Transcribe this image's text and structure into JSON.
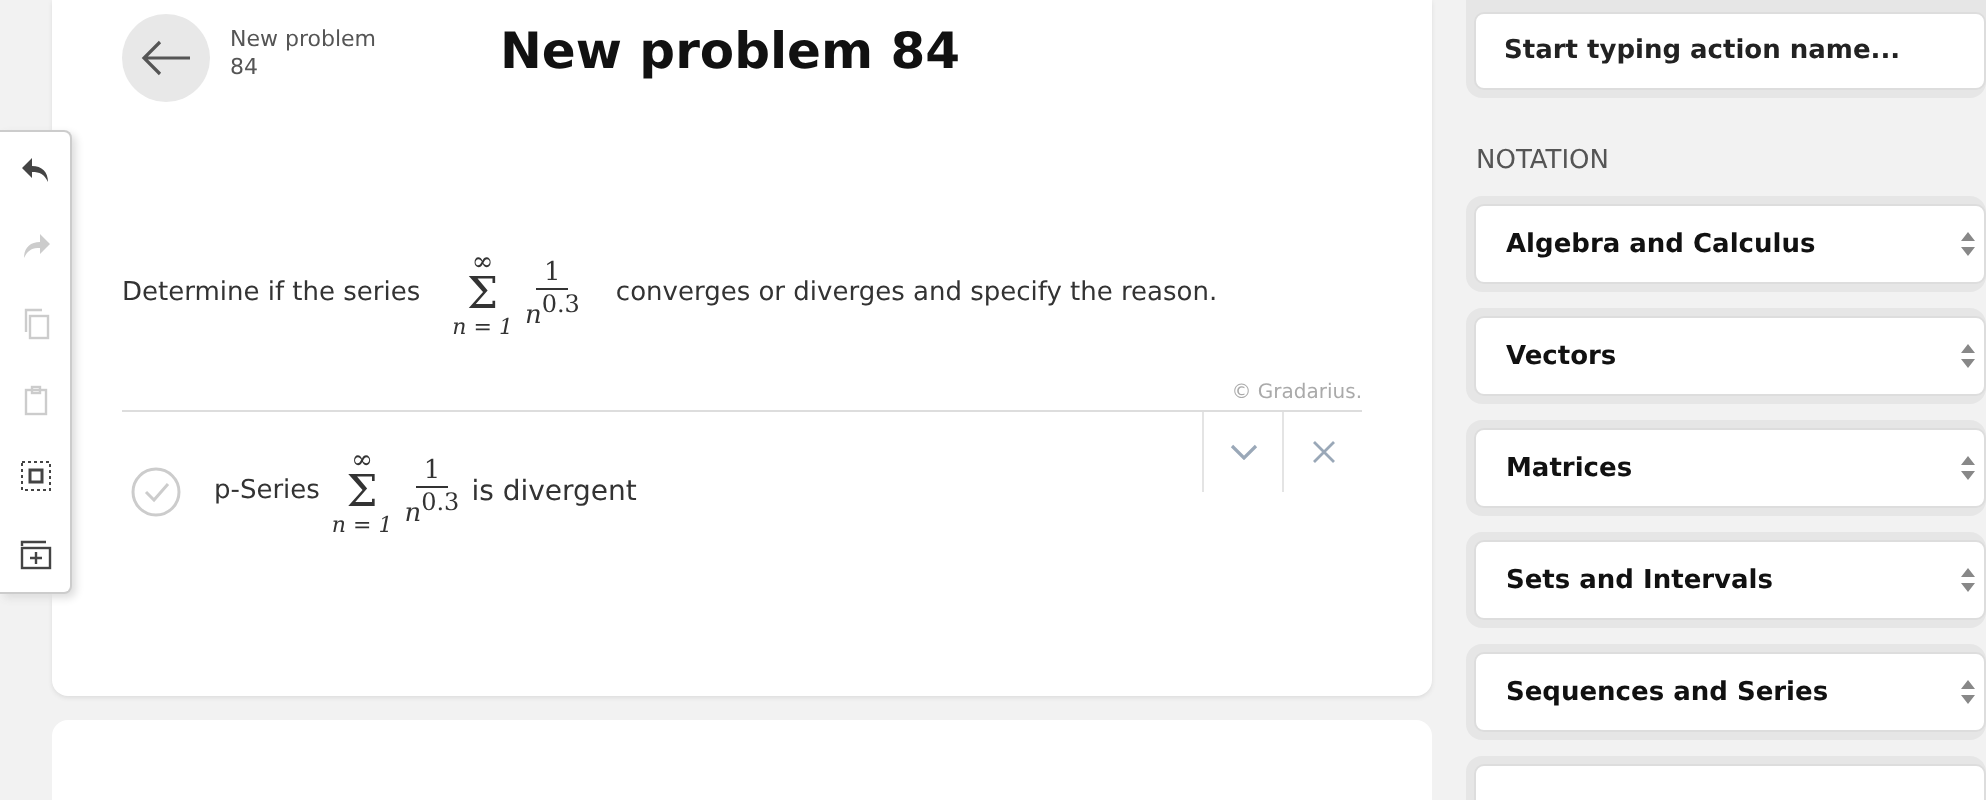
{
  "header": {
    "breadcrumb": "New problem\n84",
    "title": "New problem 84"
  },
  "toolbar": [
    {
      "kind": "undo",
      "disabled": false
    },
    {
      "kind": "redo",
      "disabled": true
    },
    {
      "kind": "copy",
      "disabled": true
    },
    {
      "kind": "paste",
      "disabled": true
    },
    {
      "kind": "select",
      "disabled": false
    },
    {
      "kind": "add",
      "disabled": false
    }
  ],
  "problem": {
    "before": "Determine if the series",
    "math": {
      "upper": "∞",
      "symbol": "Σ",
      "lower": "n = 1",
      "numerator": "1",
      "base": "n",
      "exponent": "0.3"
    },
    "after": "converges or diverges and specify the reason.",
    "credit": "© Gradarius."
  },
  "answer": {
    "checked": false,
    "before": "p-Series",
    "math": {
      "upper": "∞",
      "symbol": "Σ",
      "lower": "n = 1",
      "numerator": "1",
      "base": "n",
      "exponent": "0.3"
    },
    "after": "is divergent"
  },
  "sidebar": {
    "search": {
      "placeholder": "Start typing action name..."
    },
    "section": "NOTATION",
    "selects": [
      "Algebra and Calculus",
      "Vectors",
      "Matrices",
      "Sets and Intervals",
      "Sequences and Series"
    ]
  }
}
